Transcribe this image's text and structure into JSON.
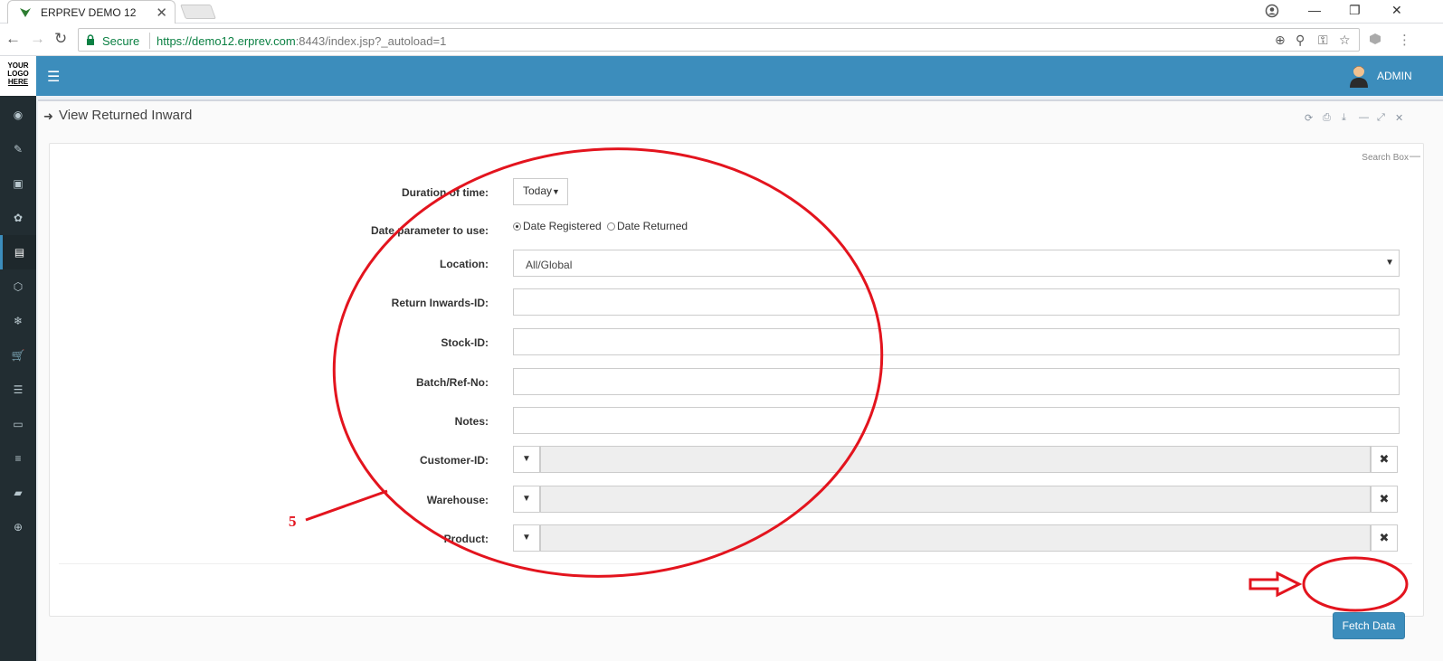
{
  "browser": {
    "tab_title": "ERPREV DEMO 12",
    "tab_close": "✕",
    "secure_label": "Secure",
    "url_scheme": "https://",
    "url_host": "demo12.erprev.com",
    "url_rest": ":8443/index.jsp?_autoload=1",
    "nav_back": "←",
    "nav_forward": "→",
    "nav_reload": "↻",
    "win_min": "—",
    "win_restore": "❐",
    "win_close": "✕",
    "omni_icons": [
      "⊕",
      "⚲",
      "⚿",
      "☆"
    ],
    "menu_icon": "⋮"
  },
  "app": {
    "logo_lines": [
      "YOUR",
      "LOGO",
      "HERE"
    ],
    "menu_toggle": "☰",
    "user_name": "ADMIN",
    "sidebar_icons": [
      "◉",
      "✎",
      "▣",
      "✿",
      "▤",
      "⬡",
      "❄",
      "🛒",
      "☰",
      "▭",
      "≡",
      "▰",
      "⊕"
    ],
    "accent": "#3c8dbc",
    "sidebar_bg": "#222d32"
  },
  "panel": {
    "title_icon": "➜",
    "title": "View Returned Inward",
    "tool_icons": [
      "⟳",
      "⎙",
      "⤓",
      "—",
      "⤢",
      "✕"
    ],
    "search_box_label": "Search Box",
    "search_box_collapse": "—"
  },
  "form": {
    "duration_label": "Duration of time:",
    "duration_value": "Today",
    "date_param_label": "Date parameter to use:",
    "date_registered": "Date Registered",
    "date_returned": "Date Returned",
    "location_label": "Location:",
    "location_value": "All/Global",
    "return_inwards_label": "Return Inwards-ID:",
    "stock_label": "Stock-ID:",
    "batch_label": "Batch/Ref-No:",
    "notes_label": "Notes:",
    "customer_label": "Customer-ID:",
    "warehouse_label": "Warehouse:",
    "product_label": "Product:",
    "combo_caret": "▼",
    "combo_clear": "✖",
    "fetch_label": "Fetch Data"
  },
  "annotation": {
    "number": "5",
    "color": "#e3141e"
  }
}
